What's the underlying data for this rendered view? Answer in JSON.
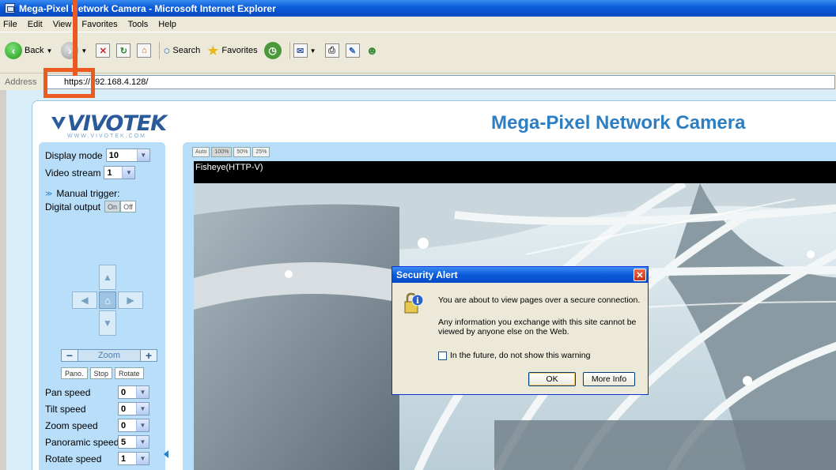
{
  "window": {
    "title": "Mega-Pixel Network Camera - Microsoft Internet Explorer"
  },
  "menu": [
    "File",
    "Edit",
    "View",
    "Favorites",
    "Tools",
    "Help"
  ],
  "toolbar": {
    "back_label": "Back",
    "search_label": "Search",
    "favorites_label": "Favorites"
  },
  "address": {
    "label": "Address",
    "url": "https://192.168.4.128/"
  },
  "page": {
    "logo_text": "VIVOTEK",
    "logo_url": "WWW.VIVOTEK.COM",
    "title": "Mega-Pixel Network Camera"
  },
  "controls": {
    "display_mode_label": "Display mode",
    "display_mode_value": "10",
    "video_stream_label": "Video stream",
    "video_stream_value": "1",
    "manual_trigger_label": "Manual trigger:",
    "digital_output_label": "Digital output",
    "on_label": "On",
    "off_label": "Off",
    "zoom_label": "Zoom",
    "zoom_minus": "−",
    "zoom_plus": "+",
    "pano_label": "Pano.",
    "stop_label": "Stop",
    "rotate_label": "Rotate",
    "pan_speed_label": "Pan speed",
    "pan_speed_value": "0",
    "tilt_speed_label": "Tilt speed",
    "tilt_speed_value": "0",
    "zoom_speed_label": "Zoom speed",
    "zoom_speed_value": "0",
    "panoramic_speed_label": "Panoramic speed",
    "panoramic_speed_value": "5",
    "rotate_speed_label": "Rotate speed",
    "rotate_speed_value": "1"
  },
  "view": {
    "size_buttons": [
      "Auto",
      "100%",
      "50%",
      "25%"
    ],
    "stream_label": "Fisheye(HTTP-V)"
  },
  "dialog": {
    "title": "Security Alert",
    "line1": "You are about to view pages over a secure connection.",
    "line2": "Any information you exchange with this site cannot be viewed by anyone else on the Web.",
    "checkbox_label": "In the future, do not show this warning",
    "ok_label": "OK",
    "more_info_label": "More Info"
  },
  "colors": {
    "accent": "#2e7fc2",
    "annotation": "#ec5a20"
  }
}
